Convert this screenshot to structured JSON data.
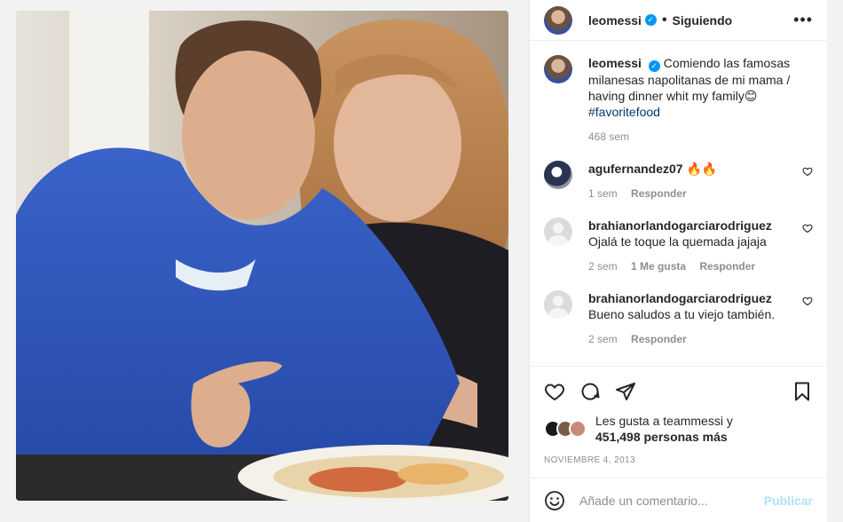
{
  "post": {
    "username": "leomessi",
    "follow_status": "Siguiendo",
    "caption_text": "Comiendo las famosas milanesas napolitanas de mi mama / having dinner whit my family😊",
    "caption_hashtag": "#favoritefood",
    "caption_time": "468 sem",
    "likes_line1": "Les gusta a teammessi y",
    "likes_line2": "451,498 personas más",
    "date": "NOVIEMBRE 4, 2013"
  },
  "comments": [
    {
      "user": "agufernandez07",
      "text": "🔥🔥",
      "time": "1 sem",
      "likes": "",
      "reply": "Responder"
    },
    {
      "user": "brahianorlandogarciarodriguez",
      "text": "Ojalá te toque la quemada jajaja",
      "time": "2 sem",
      "likes": "1 Me gusta",
      "reply": "Responder"
    },
    {
      "user": "brahianorlandogarciarodriguez",
      "text": "Bueno saludos a tu viejo también.",
      "time": "2 sem",
      "likes": "",
      "reply": "Responder"
    }
  ],
  "add_comment": {
    "placeholder": "Añade un comentario...",
    "publish_label": "Publicar"
  },
  "colors": {
    "verified": "#0095f6",
    "hashtag": "#00376b",
    "publish_disabled": "#b2dffc"
  },
  "icons": [
    "verified-icon",
    "more-icon",
    "heart-icon",
    "comment-icon",
    "share-icon",
    "bookmark-icon",
    "emoji-icon"
  ]
}
